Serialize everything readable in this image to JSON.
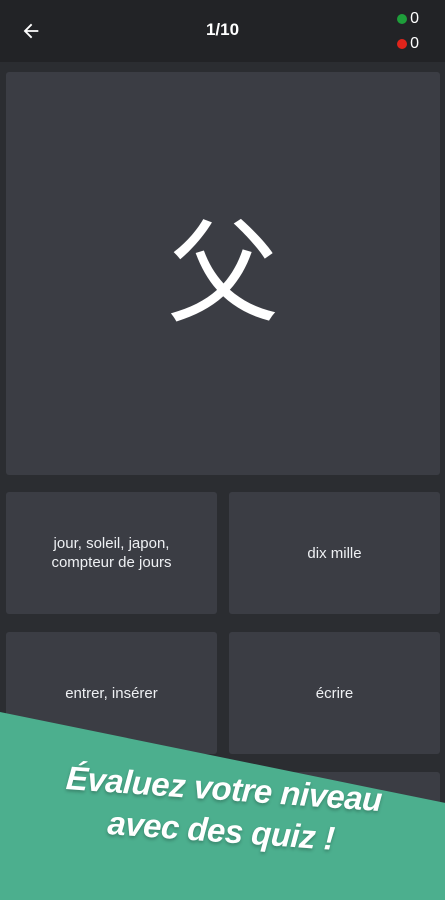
{
  "header": {
    "progress": "1/10",
    "correct_count": "0",
    "wrong_count": "0",
    "back_icon": "arrow-left-icon"
  },
  "question": {
    "kanji": "父"
  },
  "answers": [
    {
      "label": "jour,  soleil,  japon, compteur de jours"
    },
    {
      "label": "dix mille"
    },
    {
      "label": "entrer, insérer"
    },
    {
      "label": "écrire"
    },
    {
      "label": ""
    },
    {
      "label": ""
    }
  ],
  "promo": {
    "line1": "Évaluez votre niveau",
    "line2": "avec des quiz !"
  },
  "colors": {
    "background": "#2b2d31",
    "topbar": "#222326",
    "card": "#3b3d44",
    "correct_dot": "#1e9e3a",
    "wrong_dot": "#e0241b",
    "banner": "#4caf8e"
  }
}
